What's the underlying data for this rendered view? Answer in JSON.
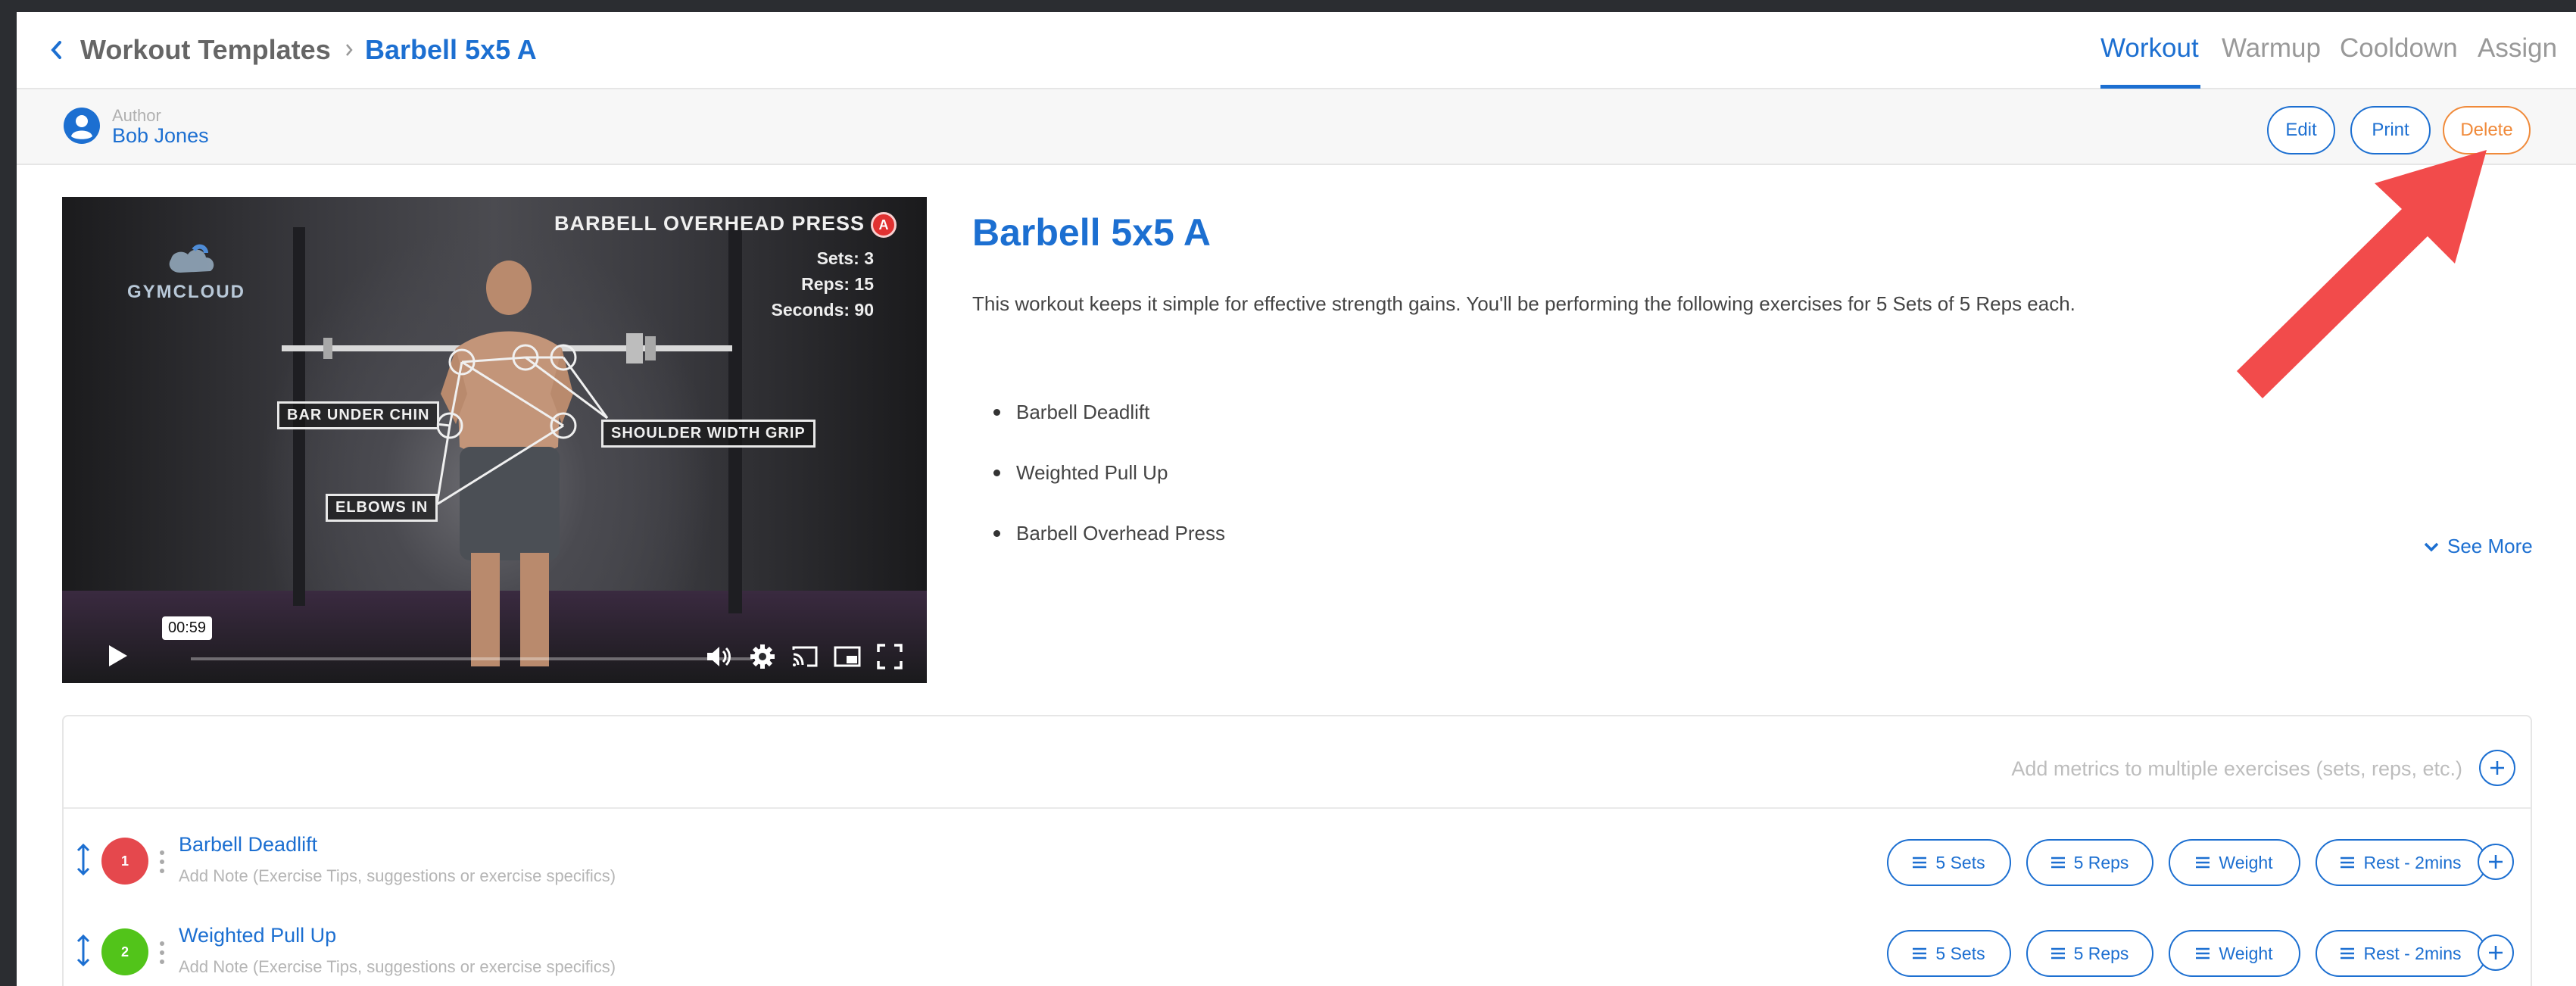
{
  "breadcrumb": {
    "parent": "Workout Templates",
    "current": "Barbell 5x5 A"
  },
  "tabs": [
    {
      "label": "Workout",
      "active": true
    },
    {
      "label": "Warmup",
      "active": false
    },
    {
      "label": "Cooldown",
      "active": false
    },
    {
      "label": "Assign",
      "active": false
    }
  ],
  "author": {
    "label": "Author",
    "name": "Bob Jones"
  },
  "actions": {
    "edit": "Edit",
    "print": "Print",
    "delete": "Delete"
  },
  "video": {
    "exercise_title": "BARBELL OVERHEAD PRESS",
    "badge": "A",
    "sets": "Sets: 3",
    "reps": "Reps: 15",
    "seconds": "Seconds: 90",
    "logo_text": "GYMCLOUD",
    "callouts": {
      "bar_under_chin": "BAR UNDER CHIN",
      "shoulder_width_grip": "SHOULDER WIDTH GRIP",
      "elbows_in": "ELBOWS IN"
    },
    "time_tooltip": "00:59",
    "progress": 0.0
  },
  "workout": {
    "title": "Barbell 5x5 A",
    "description": "This workout keeps it simple for effective strength gains. You'll be performing the following exercises for 5 Sets of 5 Reps each.",
    "exercises": [
      "Barbell Deadlift",
      "Weighted Pull Up",
      "Barbell Overhead Press"
    ],
    "see_more": "See More"
  },
  "panel": {
    "metrics_hint": "Add metrics to multiple exercises (sets, reps, etc.)",
    "rows": [
      {
        "number": "1",
        "badge_color": "#e5484d",
        "name": "Barbell Deadlift",
        "note_placeholder": "Add Note (Exercise Tips, suggestions or exercise specifics)",
        "metrics": [
          "5 Sets",
          "5 Reps",
          "Weight",
          "Rest - 2mins"
        ]
      },
      {
        "number": "2",
        "badge_color": "#52c41a",
        "name": "Weighted Pull Up",
        "note_placeholder": "Add Note (Exercise Tips, suggestions or exercise specifics)",
        "metrics": [
          "5 Sets",
          "5 Reps",
          "Weight",
          "Rest - 2mins"
        ]
      }
    ]
  },
  "colors": {
    "accent": "#1c6fd1",
    "delete": "#f08a3a",
    "annotation_arrow": "#f24b4b"
  }
}
